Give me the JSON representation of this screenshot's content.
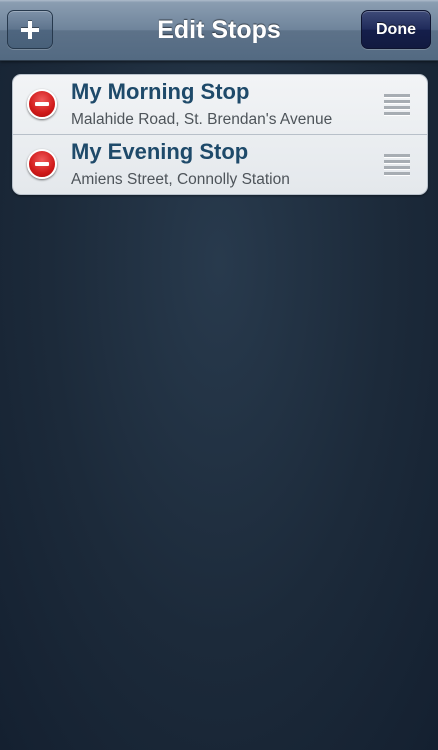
{
  "navbar": {
    "title": "Edit Stops",
    "add_icon": "plus-icon",
    "done_label": "Done"
  },
  "stops": [
    {
      "name": "My Morning Stop",
      "address": "Malahide Road, St. Brendan's Avenue"
    },
    {
      "name": "My Evening Stop",
      "address": "Amiens Street, Connolly Station"
    }
  ],
  "icons": {
    "delete": "minus-circle-icon",
    "reorder": "reorder-handle-icon"
  },
  "colors": {
    "navbar": "#6f849b",
    "done_button": "#1f2a5a",
    "delete_red": "#d01a1a",
    "stop_name": "#1e4a6a",
    "background": "#1c2a3a"
  }
}
